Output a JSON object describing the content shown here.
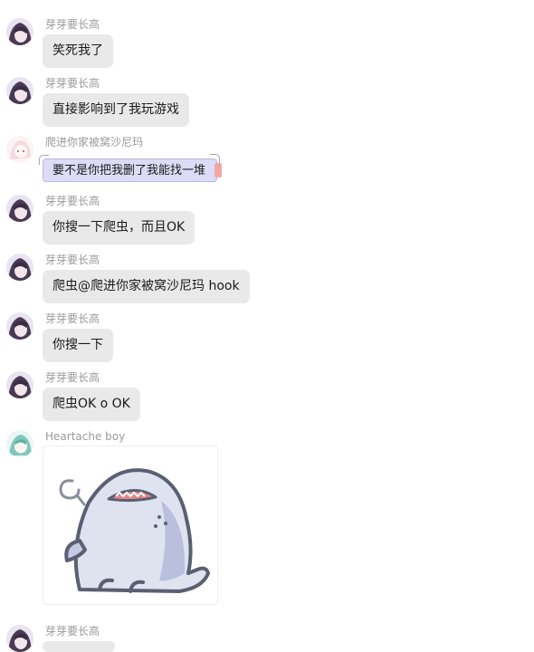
{
  "messages": [
    {
      "sender": "芽芽要长高",
      "text": "笑死我了",
      "avatar": "purple-anime-avatar"
    },
    {
      "sender": "芽芽要长高",
      "text": "直接影响到了我玩游戏",
      "avatar": "purple-anime-avatar"
    },
    {
      "sender": "爬进你家被窝沙尼玛",
      "text": "要不是你把我删了我能找一堆",
      "avatar": "pink-anime-avatar"
    },
    {
      "sender": "芽芽要长高",
      "text": "你搜一下爬虫，而且OK",
      "avatar": "purple-anime-avatar"
    },
    {
      "sender": "芽芽要长高",
      "text": "爬虫@爬进你家被窝沙尼玛 hook",
      "avatar": "purple-anime-avatar"
    },
    {
      "sender": "芽芽要长高",
      "text": "你搜一下",
      "avatar": "purple-anime-avatar"
    },
    {
      "sender": "芽芽要长高",
      "text": "爬虫OK o OK",
      "avatar": "purple-anime-avatar"
    },
    {
      "sender": "Heartache boy",
      "sticker": "shark-sticker",
      "avatar": "teal-anime-avatar"
    },
    {
      "sender": "芽芽要长高",
      "text": "",
      "avatar": "purple-anime-avatar"
    }
  ]
}
